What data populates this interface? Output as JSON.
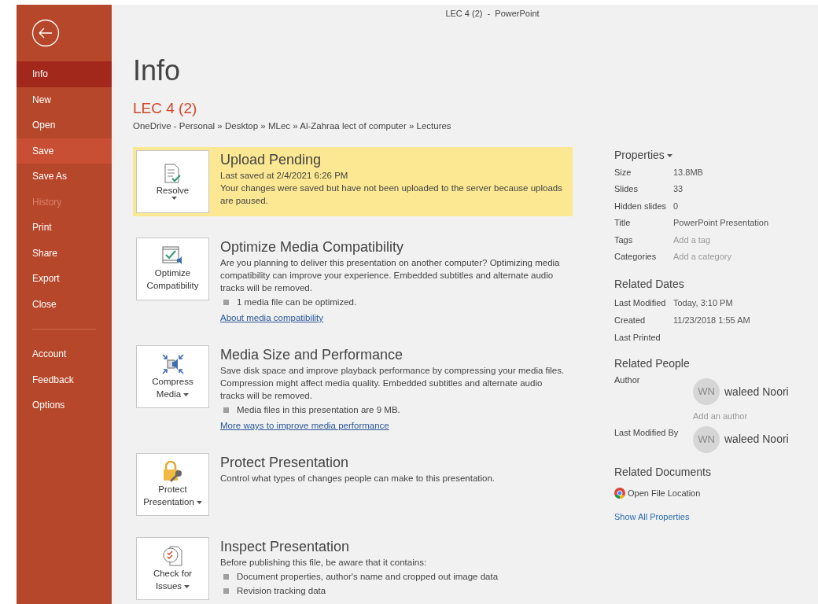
{
  "window": {
    "title": "LEC 4 (2)  -  PowerPoint"
  },
  "sidebar": {
    "items": [
      {
        "label": "Info",
        "selected": true,
        "highlighted": false,
        "disabled": false
      },
      {
        "label": "New",
        "selected": false,
        "highlighted": false,
        "disabled": false
      },
      {
        "label": "Open",
        "selected": false,
        "highlighted": false,
        "disabled": false
      },
      {
        "label": "Save",
        "selected": false,
        "highlighted": true,
        "disabled": false
      },
      {
        "label": "Save As",
        "selected": false,
        "highlighted": false,
        "disabled": false
      },
      {
        "label": "History",
        "selected": false,
        "highlighted": false,
        "disabled": true
      },
      {
        "label": "Print",
        "selected": false,
        "highlighted": false,
        "disabled": false
      },
      {
        "label": "Share",
        "selected": false,
        "highlighted": false,
        "disabled": false
      },
      {
        "label": "Export",
        "selected": false,
        "highlighted": false,
        "disabled": false
      },
      {
        "label": "Close",
        "selected": false,
        "highlighted": false,
        "disabled": false
      }
    ],
    "footer_items": [
      {
        "label": "Account",
        "selected": false,
        "highlighted": false,
        "disabled": false
      },
      {
        "label": "Feedback",
        "selected": false,
        "highlighted": false,
        "disabled": false
      },
      {
        "label": "Options",
        "selected": false,
        "highlighted": false,
        "disabled": false
      }
    ]
  },
  "page": {
    "heading": "Info",
    "file_name": "LEC 4 (2)",
    "path": "OneDrive - Personal » Desktop » MLec » Al-Zahraa lect of computer » Lectures"
  },
  "sections": [
    {
      "kind": "upload",
      "highlighted": true,
      "button": {
        "lines": [
          "Resolve"
        ],
        "dropdown": true
      },
      "title": "Upload Pending",
      "texts": [
        "Last saved at 2/4/2021 6:26 PM",
        "Your changes were saved but have not been uploaded to the server because uploads are paused."
      ]
    },
    {
      "kind": "optimize",
      "highlighted": false,
      "button": {
        "lines": [
          "Optimize",
          "Compatibility"
        ],
        "dropdown": false
      },
      "title": "Optimize Media Compatibility",
      "texts": [
        "Are you planning to deliver this presentation on another computer? Optimizing media compatibility can improve your experience. Embedded subtitles and alternate audio tracks will be removed."
      ],
      "bullets": [
        "1 media file can be optimized."
      ],
      "link": "About media compatibility"
    },
    {
      "kind": "compress",
      "highlighted": false,
      "button": {
        "lines": [
          "Compress",
          "Media"
        ],
        "dropdown": true
      },
      "title": "Media Size and Performance",
      "texts": [
        "Save disk space and improve playback performance by compressing your media files. Compression might affect media quality. Embedded subtitles and alternate audio tracks will be removed."
      ],
      "bullets": [
        "Media files in this presentation are 9 MB."
      ],
      "link": "More ways to improve media performance"
    },
    {
      "kind": "protect",
      "highlighted": false,
      "button": {
        "lines": [
          "Protect",
          "Presentation"
        ],
        "dropdown": true
      },
      "title": "Protect Presentation",
      "texts": [
        "Control what types of changes people can make to this presentation."
      ]
    },
    {
      "kind": "inspect",
      "highlighted": false,
      "button": {
        "lines": [
          "Check for",
          "Issues"
        ],
        "dropdown": true
      },
      "title": "Inspect Presentation",
      "texts": [
        "Before publishing this file, be aware that it contains:"
      ],
      "bullets": [
        "Document properties, author's name and cropped out image data",
        "Revision tracking data"
      ]
    }
  ],
  "properties": {
    "heading": "Properties",
    "rows": [
      {
        "label": "Size",
        "value": "13.8MB",
        "editable": false
      },
      {
        "label": "Slides",
        "value": "33",
        "editable": false
      },
      {
        "label": "Hidden slides",
        "value": "0",
        "editable": false
      },
      {
        "label": "Title",
        "value": "PowerPoint Presentation",
        "editable": false
      },
      {
        "label": "Tags",
        "value": "Add a tag",
        "editable": true
      },
      {
        "label": "Categories",
        "value": "Add a category",
        "editable": true
      }
    ]
  },
  "related_dates": {
    "heading": "Related Dates",
    "rows": [
      {
        "label": "Last Modified",
        "value": "Today, 3:10 PM"
      },
      {
        "label": "Created",
        "value": "11/23/2018 1:55 AM"
      },
      {
        "label": "Last Printed"
      }
    ]
  },
  "related_people": {
    "heading": "Related People",
    "author": {
      "label": "Author",
      "initials": "WN",
      "name": "waleed Noori"
    },
    "add_author": "Add an author",
    "last_modified_by": {
      "label": "Last Modified By",
      "initials": "WN",
      "name": "waleed Noori"
    }
  },
  "related_documents": {
    "heading": "Related Documents",
    "open_location": "Open File Location",
    "show_all": "Show All Properties"
  }
}
